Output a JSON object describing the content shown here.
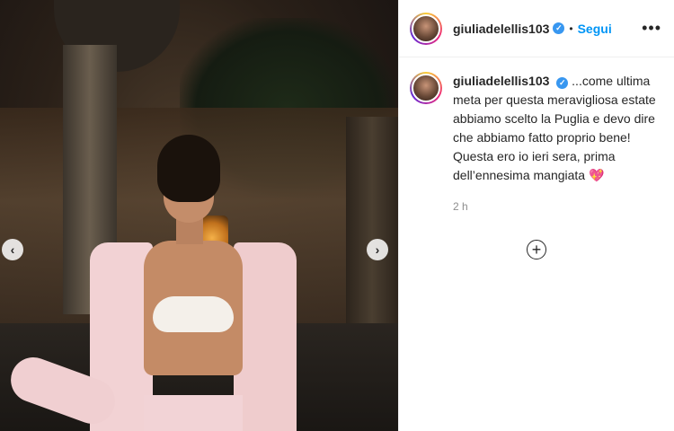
{
  "post": {
    "username": "giuliadelellis103",
    "follow_label": "Segui",
    "separator": "•",
    "more_label": "•••",
    "caption": "...come ultima meta per questa meravigliosa estate abbiamo scelto la Puglia e devo dire che abbiamo fatto proprio bene! Questa ero io ieri sera, prima dell’ennesima mangiata 💖",
    "time_ago": "2 h"
  },
  "media": {
    "prev_label": "‹",
    "next_label": "›"
  },
  "icons": {
    "verified": "✓",
    "add_comment": "+"
  },
  "colors": {
    "accent": "#0095f6",
    "verified": "#3897f0",
    "muted_text": "#8e8e8e"
  }
}
